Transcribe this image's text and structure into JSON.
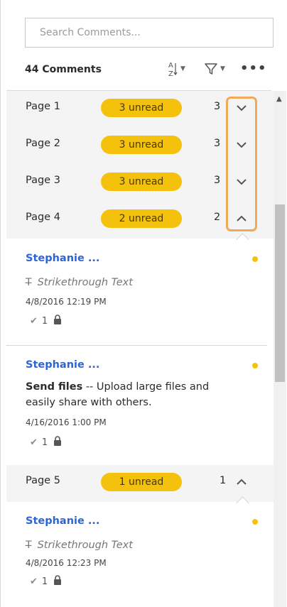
{
  "search": {
    "placeholder": "Search Comments...",
    "value": ""
  },
  "header": {
    "count_label": "44 Comments",
    "sort_icon": "sort-az-icon",
    "filter_icon": "filter-icon",
    "more_label": "•••"
  },
  "pages": [
    {
      "name": "Page 1",
      "unread": "3 unread",
      "count": "3",
      "expanded": false
    },
    {
      "name": "Page 2",
      "unread": "3 unread",
      "count": "3",
      "expanded": false
    },
    {
      "name": "Page 3",
      "unread": "3 unread",
      "count": "3",
      "expanded": false
    },
    {
      "name": "Page 4",
      "unread": "2 unread",
      "count": "2",
      "expanded": true
    },
    {
      "name": "Page 5",
      "unread": "1 unread",
      "count": "1",
      "expanded": true
    }
  ],
  "comments": [
    {
      "author": "Stephanie ...",
      "subject": "Strikethrough Text",
      "date": "4/8/2016  12:19 PM",
      "replies": "1"
    },
    {
      "author": "Stephanie ...",
      "body_bold": "Send files",
      "body_rest": " -- Upload large files and easily share with others.",
      "date": "4/16/2016  1:00 PM",
      "replies": "1"
    },
    {
      "author": "Stephanie ...",
      "subject": "Strikethrough Text",
      "date": "4/8/2016  12:23 PM",
      "replies": "1"
    }
  ],
  "colors": {
    "unread_badge": "#f4c20d",
    "author": "#2f64d6",
    "highlight": "#f1a857"
  }
}
